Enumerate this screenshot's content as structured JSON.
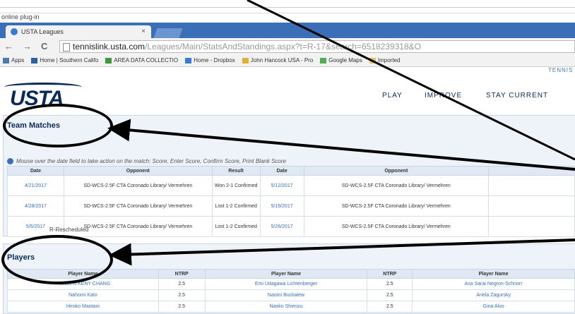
{
  "browser": {
    "notice": "online plug-in",
    "tab_title": "USTA Leagues",
    "tab_close": "×",
    "url_domain": "tennislink.usta.com",
    "url_path": "/Leagues/Main/StatsAndStandings.aspx?t=R-17&search=6518239318&O",
    "nav_back": "←",
    "nav_forward": "→",
    "nav_reload": "C",
    "bookmarks": [
      {
        "label": "Apps",
        "color": "#4a7ab0"
      },
      {
        "label": "Home | Southern Califo",
        "color": "#2d5fa8"
      },
      {
        "label": "AREA DATA COLLECTIO",
        "color": "#3a9a3a"
      },
      {
        "label": "Home - Dropbox",
        "color": "#3a7bd5"
      },
      {
        "label": "John Hancock USA - Pro",
        "color": "#e0b030"
      },
      {
        "label": "Google Maps",
        "color": "#4caf50"
      },
      {
        "label": "Imported",
        "color": "#e8c35a"
      }
    ]
  },
  "site": {
    "top_link": "TENNIS",
    "logo": "USTA",
    "menu": [
      "PLAY",
      "IMPROVE",
      "STAY CURRENT"
    ]
  },
  "team_matches": {
    "title": "Team Matches",
    "hint": "Mouse over the date field to take action on the match: Score, Enter Score, Confirm Score, Print Blank Score",
    "headers": [
      "Date",
      "Opponent",
      "Result",
      "Date",
      "Opponent"
    ],
    "rows": [
      {
        "date1": "4/21/2017",
        "opp1": "SD-WCS-2.5F CTA Coronado Library/ Vermehren",
        "result1": "Won 2-1 Confirmed",
        "date2": "5/12/2017",
        "opp2": "SD-WCS-2.5F CTA Coronado Library/ Vermehren"
      },
      {
        "date1": "4/28/2017",
        "opp1": "SD-WCS-2.5F CTA Coronado Library/ Vermehren",
        "result1": "Lost 1-2 Confirmed",
        "date2": "5/19/2017",
        "opp2": "SD-WCS-2.5F CTA Coronado Library/ Vermehren"
      },
      {
        "date1": "5/5/2017",
        "opp1": "SD-WCS-2.5F CTA Coronado Library/ Vermehren",
        "result1": "Lost 1-2 Confirmed",
        "date2": "5/26/2017",
        "opp2": "SD-WCS-2.5F CTA Coronado Library/ Vermehren"
      }
    ],
    "note": "R-Rescheduled"
  },
  "players": {
    "title": "Players",
    "headers": [
      "Player Name",
      "NTRP",
      "Player Name",
      "NTRP",
      "Player Name"
    ],
    "rows": [
      [
        "HUNSEN KENY CHANG",
        "2.5",
        "Emi Udagawa Lichtenberger",
        "2.5",
        "Axa Sarai Negron-Schnorr"
      ],
      [
        "Nahomi Kato",
        "2.5",
        "Naomi Buckalew",
        "2.5",
        "Ariela Zagursky"
      ],
      [
        "Hiroko Maotani",
        "2.5",
        "Naoko Shimizu",
        "2.5",
        "Gina Alvo"
      ]
    ]
  }
}
